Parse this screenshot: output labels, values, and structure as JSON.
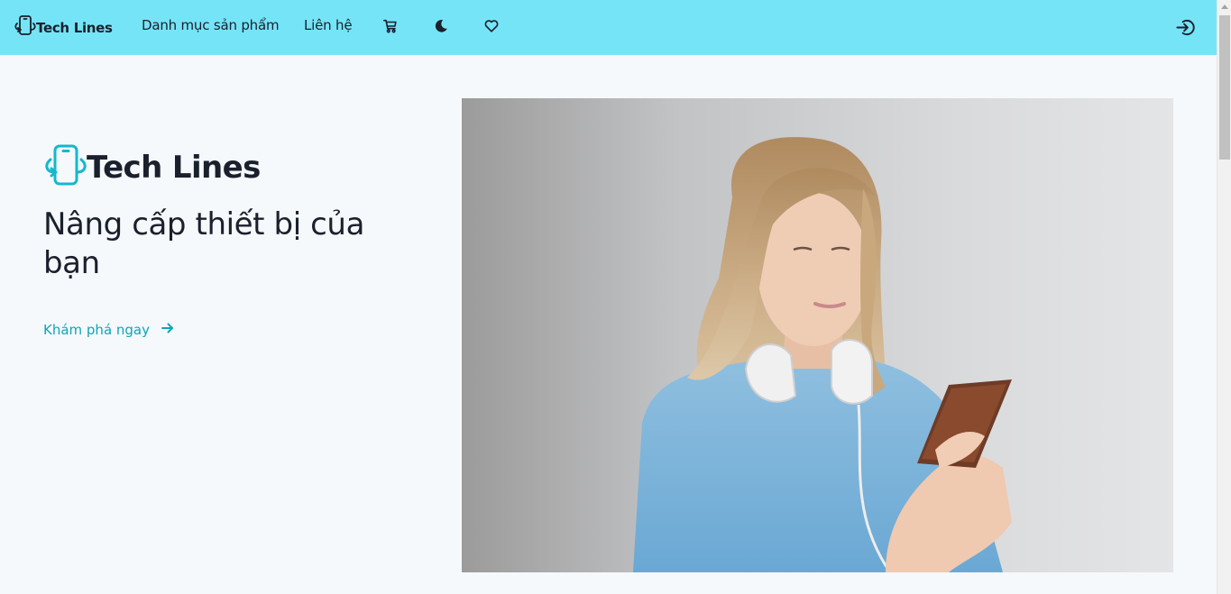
{
  "navbar": {
    "brand": "Tech Lines",
    "links": [
      "Danh mục sản phẩm",
      "Liên hệ"
    ],
    "icons": [
      "cart-icon",
      "moon-icon",
      "heart-icon",
      "login-icon"
    ]
  },
  "hero": {
    "brand": "Tech Lines",
    "title": "Nâng cấp thiết bị của bạn",
    "cta": "Khám phá ngay"
  },
  "colors": {
    "navbar_bg": "#76e4f7",
    "accent": "#0ea5b9",
    "page_bg": "#f6f9fc"
  }
}
